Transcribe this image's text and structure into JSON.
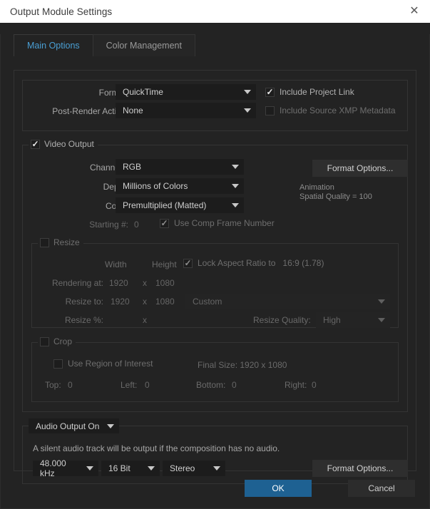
{
  "window": {
    "title": "Output Module Settings",
    "close_icon": "close-icon"
  },
  "tabs": [
    {
      "label": "Main Options",
      "active": true
    },
    {
      "label": "Color Management",
      "active": false
    }
  ],
  "format_group": {
    "format_label": "Format:",
    "format_value": "QuickTime",
    "post_render_label": "Post-Render Action:",
    "post_render_value": "None",
    "include_project_link": {
      "label": "Include Project Link",
      "checked": true,
      "mark": "✓"
    },
    "include_xmp": {
      "label": "Include Source XMP Metadata",
      "checked": false,
      "mark": ""
    }
  },
  "video_output": {
    "legend": "Video Output",
    "checked": true,
    "mark": "✓",
    "channels_label": "Channels:",
    "channels_value": "RGB",
    "depth_label": "Depth:",
    "depth_value": "Millions of Colors",
    "color_label": "Color:",
    "color_value": "Premultiplied (Matted)",
    "starting_label": "Starting #:",
    "starting_value": "0",
    "use_comp_frame": {
      "label": "Use Comp Frame Number",
      "checked": true,
      "mark": "✓"
    },
    "format_options_button": "Format Options...",
    "codec_name": "Animation",
    "codec_quality": "Spatial Quality = 100"
  },
  "resize": {
    "legend": "Resize",
    "checked": false,
    "mark": "",
    "width_header": "Width",
    "height_header": "Height",
    "lock_aspect": {
      "label": "Lock Aspect Ratio to",
      "value": "16:9 (1.78)",
      "checked": true,
      "mark": "✓"
    },
    "rendering_at_label": "Rendering at:",
    "rendering_width": "1920",
    "rendering_x": "x",
    "rendering_height": "1080",
    "resize_to_label": "Resize to:",
    "resize_width": "1920",
    "resize_x": "x",
    "resize_height": "1080",
    "preset_value": "Custom",
    "resize_pct_label": "Resize %:",
    "resize_pct_x": "x",
    "resize_quality_label": "Resize Quality:",
    "resize_quality_value": "High"
  },
  "crop": {
    "legend": "Crop",
    "checked": false,
    "mark": "",
    "use_region": {
      "label": "Use Region of Interest",
      "checked": false,
      "mark": ""
    },
    "final_size": "Final Size: 1920 x 1080",
    "top_label": "Top:",
    "top_value": "0",
    "left_label": "Left:",
    "left_value": "0",
    "bottom_label": "Bottom:",
    "bottom_value": "0",
    "right_label": "Right:",
    "right_value": "0"
  },
  "audio": {
    "legend": "Audio Output On",
    "note": "A silent audio track will be output if the composition has no audio.",
    "sample_rate": "48.000 kHz",
    "bit_depth": "16 Bit",
    "channels": "Stereo",
    "format_options_button": "Format Options..."
  },
  "footer": {
    "ok_label": "OK",
    "cancel_label": "Cancel"
  },
  "colors": {
    "accent": "#1e6192",
    "tab_active_text": "#4a9fd4",
    "dialog_bg": "#232323",
    "titlebar_bg": "#ffffff"
  }
}
